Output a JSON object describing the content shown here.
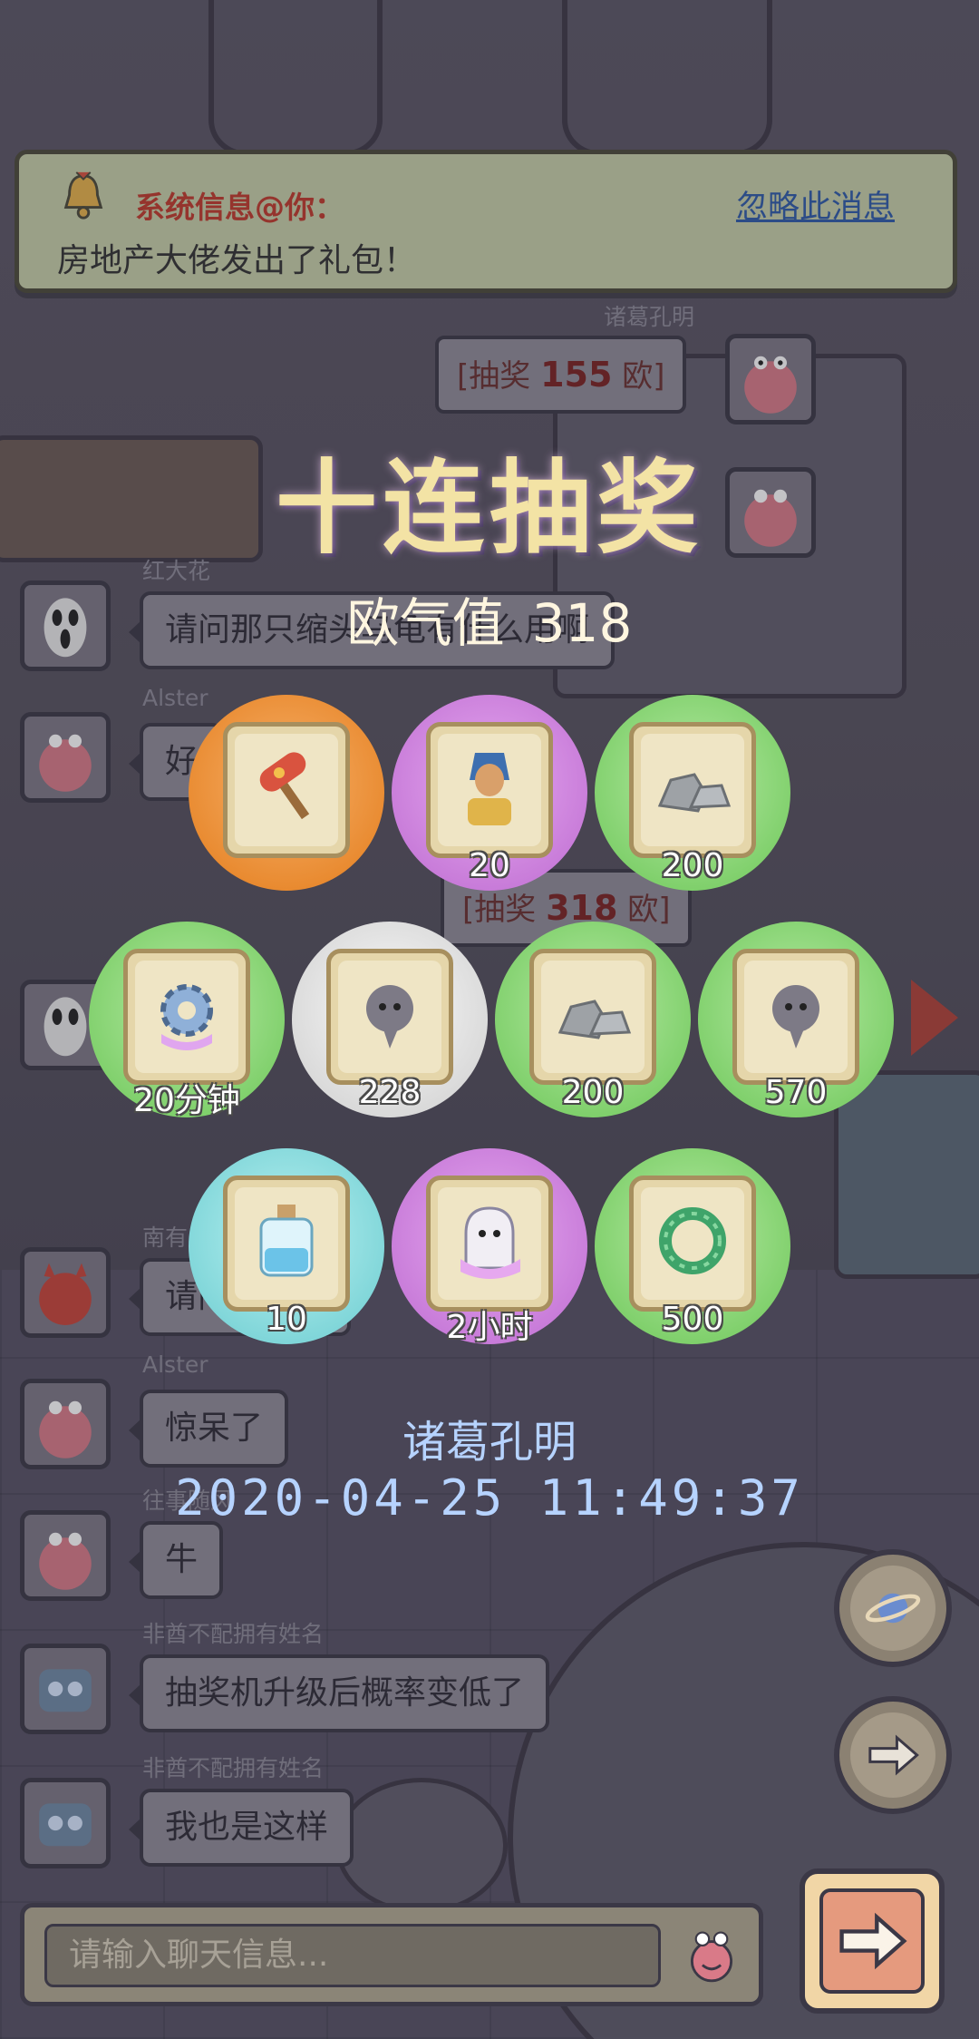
{
  "system_banner": {
    "title": "系统信息@你：",
    "ignore_label": "忽略此消息",
    "message": "房地产大佬发出了礼包！"
  },
  "chat": {
    "right_messages": [
      {
        "name": "诸葛孔明",
        "text_prefix": "[抽奖 ",
        "amount": "155",
        "text_suffix": " 欧]"
      },
      {
        "name": "",
        "text_prefix": "[抽奖 ",
        "amount": "318",
        "text_suffix": " 欧]"
      }
    ],
    "left_messages": [
      {
        "name": "红大花",
        "text": "请问那只缩头乌龟有什么用啊"
      },
      {
        "name": "Alster",
        "text": "好"
      },
      {
        "name": "南有",
        "text": "请问...有..."
      },
      {
        "name": "Alster",
        "text": "惊呆了"
      },
      {
        "name": "往事随风",
        "text": "牛"
      },
      {
        "name": "非酋不配拥有姓名",
        "text": "抽奖机升级后概率变低了"
      },
      {
        "name": "非酋不配拥有姓名",
        "text": "我也是这样"
      }
    ],
    "input_placeholder": "请输入聊天信息..."
  },
  "lottery": {
    "title": "十连抽奖",
    "luck_label": "欧气值",
    "luck_value": "318",
    "prizes": [
      {
        "item": "rocket-hammer",
        "rarity": "orange",
        "qty": ""
      },
      {
        "item": "pharaoh-bust",
        "rarity": "purple",
        "qty": "20"
      },
      {
        "item": "stones",
        "rarity": "green",
        "qty": "200"
      },
      {
        "item": "gear",
        "rarity": "green",
        "qty": "20分钟"
      },
      {
        "item": "soul",
        "rarity": "white",
        "qty": "228"
      },
      {
        "item": "stones",
        "rarity": "green",
        "qty": "200"
      },
      {
        "item": "soul",
        "rarity": "green",
        "qty": "570"
      },
      {
        "item": "potion-bottle",
        "rarity": "cyan",
        "qty": "10"
      },
      {
        "item": "ghost-cloth",
        "rarity": "purple",
        "qty": "2小时"
      },
      {
        "item": "green-wreath",
        "rarity": "green",
        "qty": "500"
      }
    ],
    "winner": "诸葛孔明",
    "timestamp": "2020-04-25  11:49:37"
  },
  "colors": {
    "banner_bg": "#c7cfa8",
    "sys_title": "#c0392b",
    "link": "#2f5aa8",
    "winner_text": "#b6d3ff"
  }
}
